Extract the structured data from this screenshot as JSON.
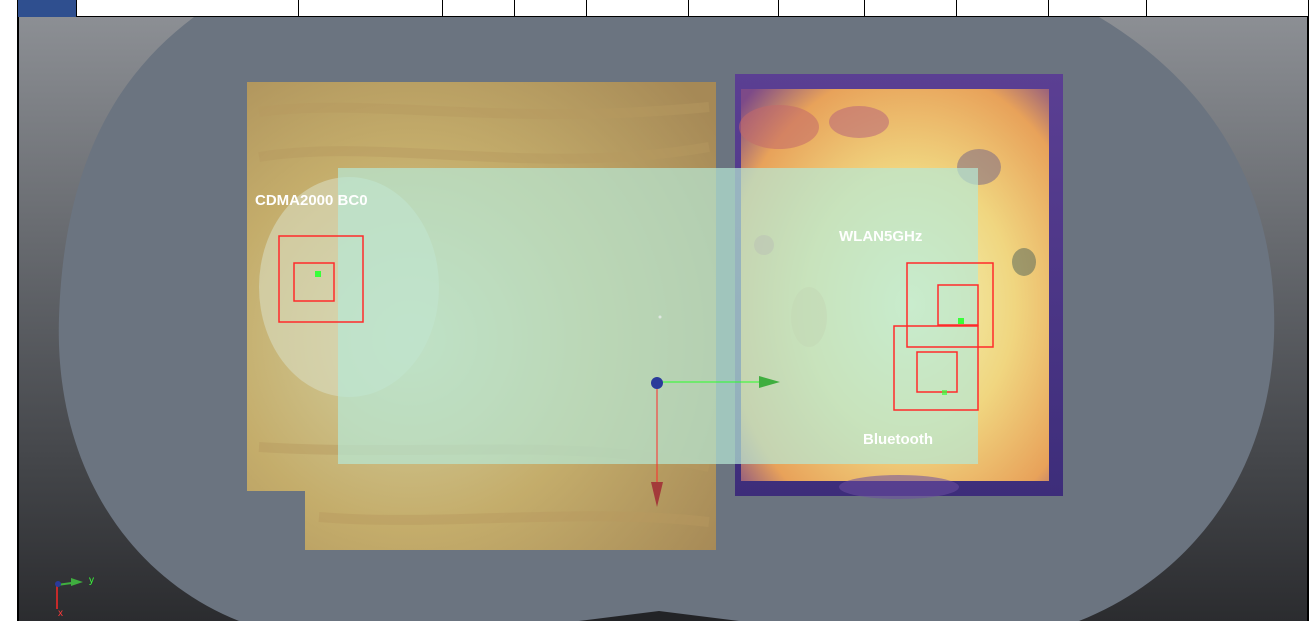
{
  "labels": {
    "cdma": "CDMA2000 BC0",
    "wlan": "WLAN5GHz",
    "bluetooth": "Bluetooth"
  },
  "triad": {
    "y": "y",
    "x": "x"
  },
  "colors": {
    "head": "#6b7480",
    "overlay": "#b6e8d6",
    "box": "#ff2a2a",
    "marker": "#39ff39",
    "axis_x": "#ff2a2a",
    "axis_y": "#2aff2a",
    "origin": "#2a3a9a"
  },
  "icons": [
    "origin-sphere-icon",
    "x-arrow-icon",
    "y-arrow-icon",
    "axis-triad-icon"
  ]
}
